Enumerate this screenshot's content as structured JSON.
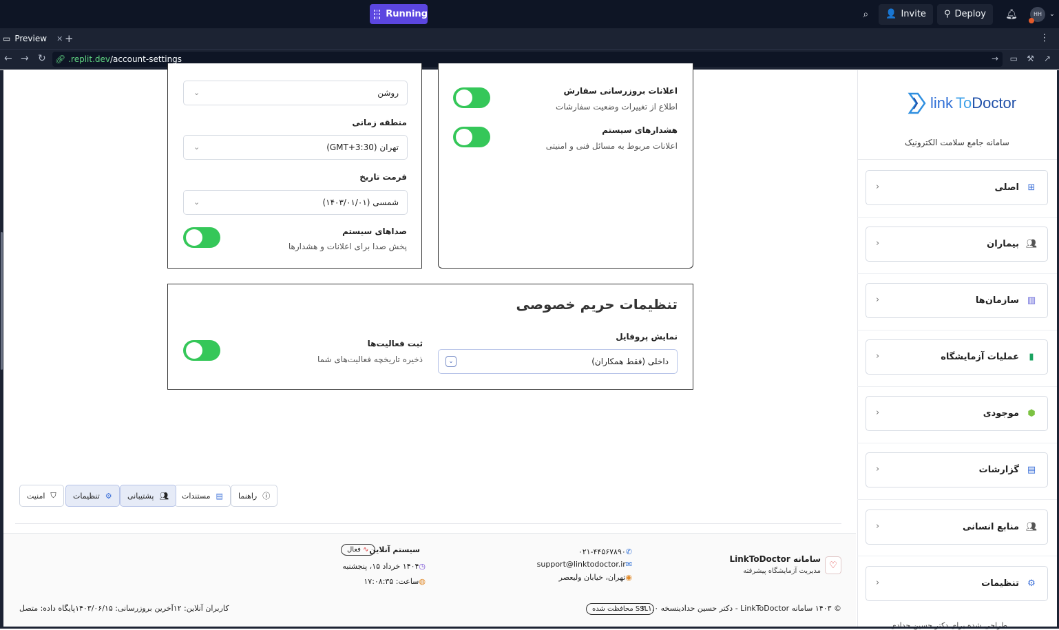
{
  "replit": {
    "run_label": "Running",
    "invite_label": "Invite",
    "deploy_label": "Deploy",
    "avatar_initials": "HH",
    "tab_label": "Preview",
    "url_domain": ".replit.dev",
    "url_path": "/account-settings"
  },
  "sidebar": {
    "logo_part1": "link",
    "logo_part2a": "To",
    "logo_part2b": "Doctor",
    "tagline": "سامانه جامع سلامت الکترونیک",
    "items": [
      {
        "label": "اصلی",
        "icon": "dashboard-icon"
      },
      {
        "label": "بیماران",
        "icon": "users-icon"
      },
      {
        "label": "سازمان‌ها",
        "icon": "building-icon"
      },
      {
        "label": "عملیات آزمایشگاه",
        "icon": "test-tube-icon"
      },
      {
        "label": "موجودی",
        "icon": "box-icon"
      },
      {
        "label": "گزارشات",
        "icon": "bar-chart-icon"
      },
      {
        "label": "منابع انسانی",
        "icon": "users-icon"
      },
      {
        "label": "تنظیمات",
        "icon": "gear-icon"
      }
    ],
    "footer_text": "طراحی شده برای دکتر حسین حدادی"
  },
  "display_settings": {
    "theme_value": "روشن",
    "timezone_label": "منطقه زمانی",
    "timezone_value": "تهران (GMT+3:30)",
    "date_format_label": "فرمت تاریخ",
    "date_format_value": "شمسی (۱۴۰۳/۰۱/۰۱)",
    "sounds_label": "صداهای سیستم",
    "sounds_desc": "پخش صدا برای اعلانات و هشدارها"
  },
  "notifications": {
    "order_label": "اعلانات بروزرسانی سفارش",
    "order_desc": "اطلاع از تغییرات وضعیت سفارشات",
    "alerts_label": "هشدارهای سیستم",
    "alerts_desc": "اعلانات مربوط به مسائل فنی و امنیتی"
  },
  "privacy": {
    "title": "تنظیمات حریم خصوصی",
    "profile_label": "نمایش پروفایل",
    "profile_value": "داخلی (فقط همکاران)",
    "activity_label": "ثبت فعالیت‌ها",
    "activity_desc": "ذخیره تاریخچه فعالیت‌های شما"
  },
  "footer": {
    "brand_title": "سامانه LinkToDoctor",
    "brand_sub": "مدیریت آزمایشگاه پیشرفته",
    "phone": "۰۲۱-۴۴۵۶۷۸۹۰",
    "email": "support@linktodoctor.ir",
    "address": "تهران، خیابان ولیعصر",
    "system_status": "سیستم آنلاین",
    "status_badge": "فعال",
    "date": "۱۴۰۴ خرداد ۱۵، پنجشنبه",
    "time": "ساعت: ۱۷:۰۸:۳۵",
    "buttons": [
      {
        "label": "راهنما",
        "icon": "help-icon"
      },
      {
        "label": "مستندات",
        "icon": "document-icon"
      },
      {
        "label": "پشتیبانی",
        "icon": "users-icon"
      },
      {
        "label": "تنظیمات",
        "icon": "gear-icon"
      },
      {
        "label": "امنیت",
        "icon": "shield-icon"
      }
    ],
    "copyright": "© ۱۴۰۳ سامانه LinkToDoctor - دکتر حسین حدادی",
    "version": "نسخه ۲.۱.۰",
    "ssl_badge": "SSL محافظت شده",
    "online_users": "کاربران آنلاین: ۱۲",
    "last_update": "آخرین بروزرسانی: ۱۴۰۳/۰۶/۱۵",
    "db_status": "پایگاه داده: متصل"
  }
}
